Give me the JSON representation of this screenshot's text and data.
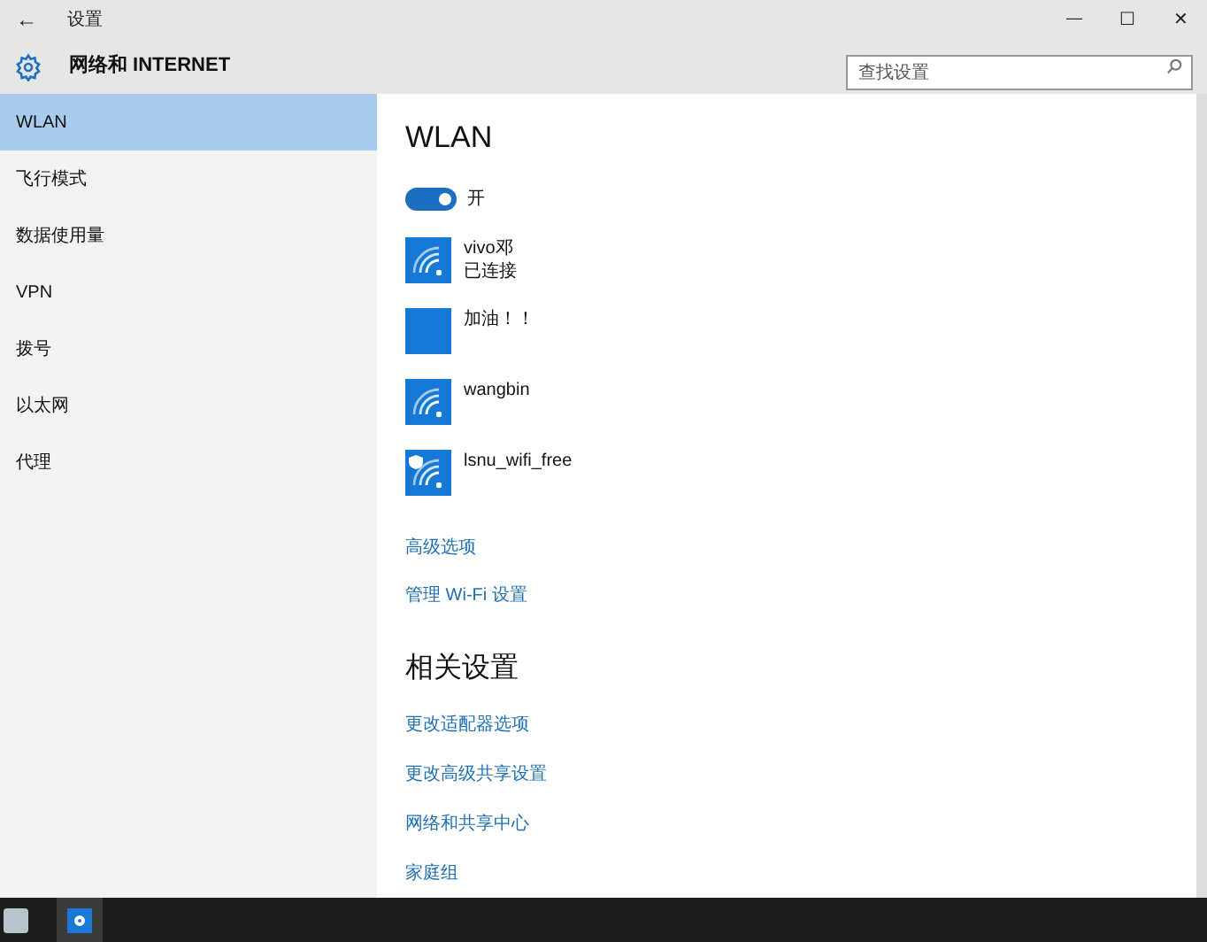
{
  "window": {
    "title": "设置",
    "back": "←",
    "minimize": "—",
    "maximize": "☐",
    "close": "✕"
  },
  "header": {
    "title": "网络和 INTERNET",
    "search": {
      "placeholder": "查找设置"
    }
  },
  "sidebar": {
    "items": [
      {
        "label": "WLAN",
        "selected": true
      },
      {
        "label": "飞行模式",
        "selected": false
      },
      {
        "label": "数据使用量",
        "selected": false
      },
      {
        "label": "VPN",
        "selected": false
      },
      {
        "label": "拨号",
        "selected": false
      },
      {
        "label": "以太网",
        "selected": false
      },
      {
        "label": "代理",
        "selected": false
      }
    ]
  },
  "content": {
    "title": "WLAN",
    "toggle": {
      "on": true,
      "label": "开"
    },
    "networks": [
      {
        "kind": "wifi",
        "name": "vivo邓",
        "status": "已连接"
      },
      {
        "kind": "plain",
        "name": "加油！！"
      },
      {
        "kind": "wifi",
        "name": "wangbin"
      },
      {
        "kind": "secured",
        "name": "lsnu_wifi_free"
      }
    ],
    "links": [
      "高级选项",
      "管理 Wi-Fi 设置"
    ],
    "related_title": "相关设置",
    "related_links": [
      "更改适配器选项",
      "更改高级共享设置",
      "网络和共享中心",
      "家庭组"
    ]
  }
}
